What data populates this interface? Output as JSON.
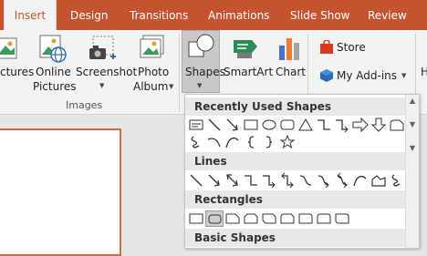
{
  "tabs": [
    "Insert",
    "Design",
    "Transitions",
    "Animations",
    "Slide Show",
    "Review"
  ],
  "active_tab": "Insert",
  "ribbon": {
    "pictures_label": "ctures",
    "online_pictures_label_1": "Online",
    "online_pictures_label_2": "Pictures",
    "screenshot_label": "Screenshot",
    "photo_album_label_1": "Photo",
    "photo_album_label_2": "Album",
    "images_group_label": "Images",
    "shapes_label": "Shapes",
    "smartart_label": "SmartArt",
    "chart_label": "Chart",
    "store_label": "Store",
    "my_addins_label": "My Add-ins",
    "right_cut_label": "H"
  },
  "gallery": {
    "sections": [
      {
        "title": "Recently Used Shapes"
      },
      {
        "title": "Lines"
      },
      {
        "title": "Rectangles"
      },
      {
        "title": "Basic Shapes"
      }
    ]
  },
  "colors": {
    "accent": "#c5532f",
    "ribbon_bg": "#f3f3f3",
    "selected_bg": "#c8c8c8"
  }
}
